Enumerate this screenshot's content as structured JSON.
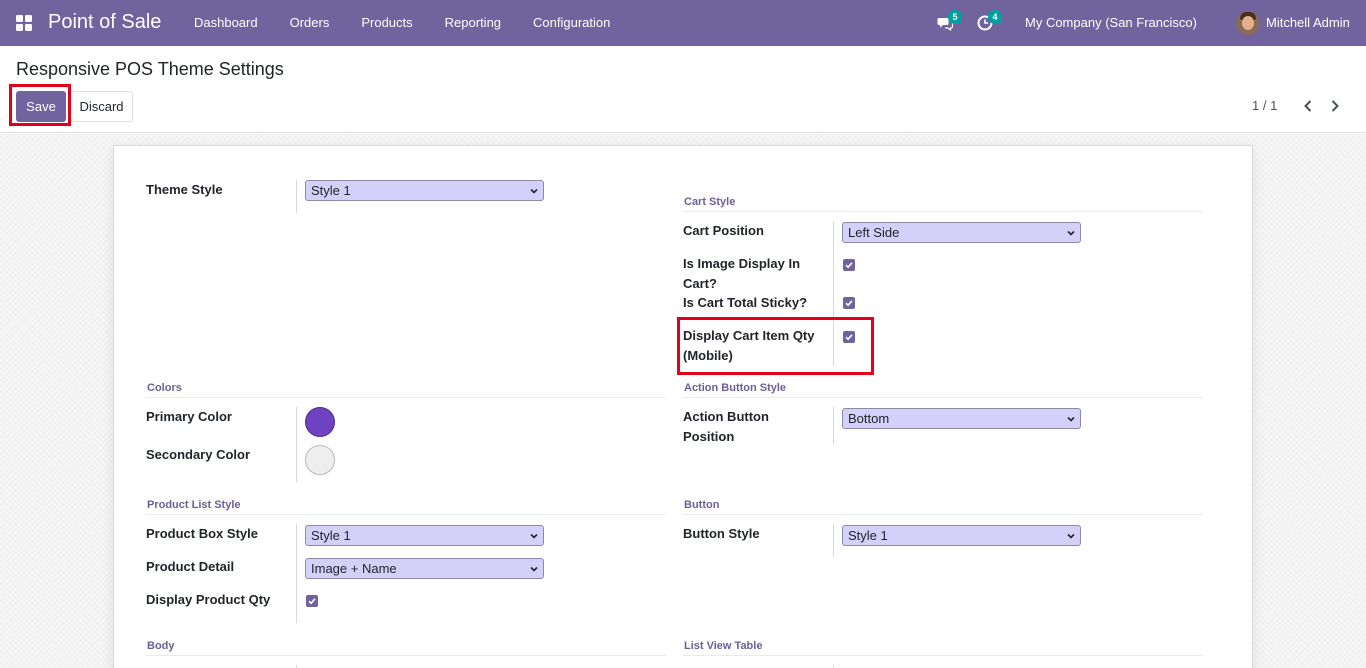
{
  "navbar": {
    "app_title": "Point of Sale",
    "menu": [
      "Dashboard",
      "Orders",
      "Products",
      "Reporting",
      "Configuration"
    ],
    "messages_count": "5",
    "activities_count": "4",
    "company": "My Company (San Francisco)",
    "user": "Mitchell Admin"
  },
  "control_panel": {
    "breadcrumb": "Responsive POS Theme Settings",
    "save_label": "Save",
    "discard_label": "Discard",
    "pager": "1 / 1"
  },
  "form": {
    "theme_style": {
      "label": "Theme Style",
      "value": "Style 1"
    },
    "cart_style": {
      "title": "Cart Style",
      "cart_position": {
        "label": "Cart Position",
        "value": "Left Side"
      },
      "is_image_display_line1": "Is Image Display In",
      "is_image_display_line2": "Cart?",
      "is_image_display_checked": true,
      "is_cart_total_sticky": "Is Cart Total Sticky?",
      "is_cart_total_sticky_checked": true,
      "display_cart_qty_line1": "Display Cart Item Qty",
      "display_cart_qty_line2": "(Mobile)",
      "display_cart_qty_checked": true
    },
    "colors": {
      "title": "Colors",
      "primary_label": "Primary Color",
      "primary_color": "#6f42c1",
      "secondary_label": "Secondary Color",
      "secondary_color": "#eeeeee"
    },
    "action_button_style": {
      "title": "Action Button Style",
      "position_line1": "Action Button",
      "position_line2": "Position",
      "position_value": "Bottom"
    },
    "product_list_style": {
      "title": "Product List Style",
      "box_style": {
        "label": "Product Box Style",
        "value": "Style 1"
      },
      "detail": {
        "label": "Product Detail",
        "value": "Image + Name"
      },
      "display_qty": {
        "label": "Display Product Qty",
        "checked": true
      }
    },
    "button": {
      "title": "Button",
      "style": {
        "label": "Button Style",
        "value": "Style 1"
      }
    },
    "body": {
      "title": "Body"
    },
    "list_view_table": {
      "title": "List View Table"
    }
  },
  "colors": {
    "brand": "#71639e",
    "select_bg": "#d3d0f9",
    "highlight": "#e2001a",
    "badge": "#00a09d"
  }
}
